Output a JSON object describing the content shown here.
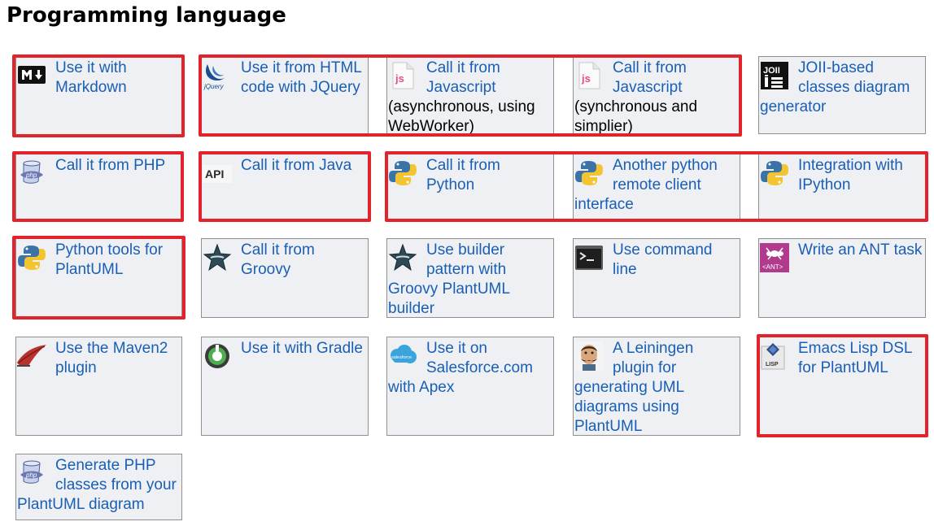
{
  "page": {
    "title": "Programming language"
  },
  "colors": {
    "link": "#1a5fb4",
    "card_bg": "#eef0f4",
    "highlight": "#e3232c"
  },
  "cards": [
    {
      "icon": "markdown-icon",
      "label": "Use it with Markdown"
    },
    {
      "icon": "jquery-icon",
      "label": "Use it from HTML code with JQuery"
    },
    {
      "icon": "javascript-file-icon",
      "label": "Call it from Javascript",
      "extra": "(asynchronous, using WebWorker)"
    },
    {
      "icon": "javascript-file-icon",
      "label": "Call it from Javascript",
      "extra": "(synchronous and simplier)"
    },
    {
      "icon": "joii-icon",
      "label": "JOII-based classes diagram generator"
    },
    {
      "icon": "php-icon",
      "label": "Call it from PHP"
    },
    {
      "icon": "api-icon",
      "label": "Call it from Java"
    },
    {
      "icon": "python-icon",
      "label": "Call it from Python"
    },
    {
      "icon": "python-icon",
      "label": "Another python remote client interface"
    },
    {
      "icon": "python-icon",
      "label": "Integration with IPython"
    },
    {
      "icon": "python-icon",
      "label": "Python tools for PlantUML"
    },
    {
      "icon": "groovy-star-icon",
      "label": "Call it from Groovy"
    },
    {
      "icon": "groovy-star-icon",
      "label": "Use builder pattern with Groovy PlantUML builder"
    },
    {
      "icon": "terminal-icon",
      "label": "Use command line"
    },
    {
      "icon": "ant-icon",
      "label": "Write an ANT task"
    },
    {
      "icon": "maven-feather-icon",
      "label": "Use the Maven2 plugin"
    },
    {
      "icon": "gradle-icon",
      "label": "Use it with Gradle"
    },
    {
      "icon": "salesforce-cloud-icon",
      "label": "Use it on Salesforce.com with Apex"
    },
    {
      "icon": "leiningen-icon",
      "label": "A Leiningen plugin for generating UML diagrams using PlantUML"
    },
    {
      "icon": "lisp-icon",
      "label": "Emacs Lisp DSL for PlantUML"
    },
    {
      "icon": "php-icon",
      "label": "Generate PHP classes from your PlantUML diagram"
    }
  ],
  "icon_labels": {
    "jquery": "jQuery",
    "js": "js",
    "api": "API",
    "joii": "JOII",
    "php": "php",
    "ant": "<ANT>",
    "salesforce": "salesforce",
    "lisp": "LISP"
  }
}
